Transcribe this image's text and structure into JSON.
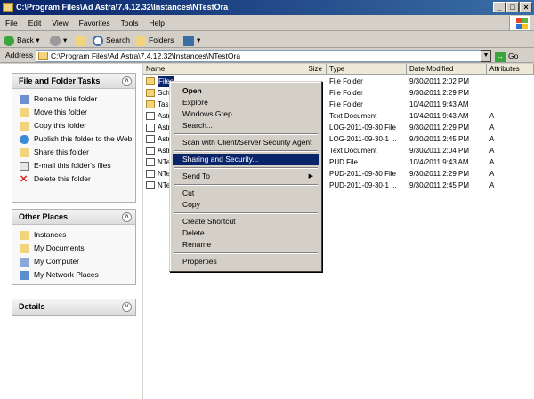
{
  "window": {
    "title": "C:\\Program Files\\Ad Astra\\7.4.12.32\\Instances\\NTestOra"
  },
  "menubar": {
    "items": [
      "File",
      "Edit",
      "View",
      "Favorites",
      "Tools",
      "Help"
    ]
  },
  "toolbar": {
    "back": "Back",
    "search": "Search",
    "folders": "Folders"
  },
  "address": {
    "label": "Address",
    "value": "C:\\Program Files\\Ad Astra\\7.4.12.32\\Instances\\NTestOra",
    "go": "Go"
  },
  "tasks": {
    "file_folder": {
      "title": "File and Folder Tasks",
      "items": [
        "Rename this folder",
        "Move this folder",
        "Copy this folder",
        "Publish this folder to the Web",
        "Share this folder",
        "E-mail this folder's files",
        "Delete this folder"
      ]
    },
    "other_places": {
      "title": "Other Places",
      "items": [
        "Instances",
        "My Documents",
        "My Computer",
        "My Network Places"
      ]
    },
    "details": {
      "title": "Details"
    }
  },
  "columns": [
    "Name",
    "Size",
    "Type",
    "Date Modified",
    "Attributes"
  ],
  "files": [
    {
      "name": "Files",
      "size": "",
      "type": "File Folder",
      "date": "9/30/2011 2:02 PM",
      "attr": ""
    },
    {
      "name": "Sch",
      "size": "",
      "type": "File Folder",
      "date": "9/30/2011 2:29 PM",
      "attr": ""
    },
    {
      "name": "Tas",
      "size": "",
      "type": "File Folder",
      "date": "10/4/2011 9:43 AM",
      "attr": ""
    },
    {
      "name": "Astr",
      "size": "",
      "type": "Text Document",
      "date": "10/4/2011 9:43 AM",
      "attr": "A"
    },
    {
      "name": "Astr",
      "size": "",
      "type": "LOG-2011-09-30 File",
      "date": "9/30/2011 2:29 PM",
      "attr": "A"
    },
    {
      "name": "Astr",
      "size": "",
      "type": "LOG-2011-09-30-1 ...",
      "date": "9/30/2011 2:45 PM",
      "attr": "A"
    },
    {
      "name": "Astr",
      "size": "",
      "type": "Text Document",
      "date": "9/30/2011 2:04 PM",
      "attr": "A"
    },
    {
      "name": "NTe",
      "size": "",
      "type": "PUD File",
      "date": "10/4/2011 9:43 AM",
      "attr": "A"
    },
    {
      "name": "NTe",
      "size": "",
      "type": "PUD-2011-09-30 File",
      "date": "9/30/2011 2:29 PM",
      "attr": "A"
    },
    {
      "name": "NTe",
      "size": "",
      "type": "PUD-2011-09-30-1 ...",
      "date": "9/30/2011 2:45 PM",
      "attr": "A"
    }
  ],
  "context_menu": {
    "items": [
      "Open",
      "Explore",
      "Windows Grep",
      "Search...",
      "Scan with Client/Server Security Agent",
      "Sharing and Security...",
      "Send To",
      "Cut",
      "Copy",
      "Create Shortcut",
      "Delete",
      "Rename",
      "Properties"
    ]
  }
}
